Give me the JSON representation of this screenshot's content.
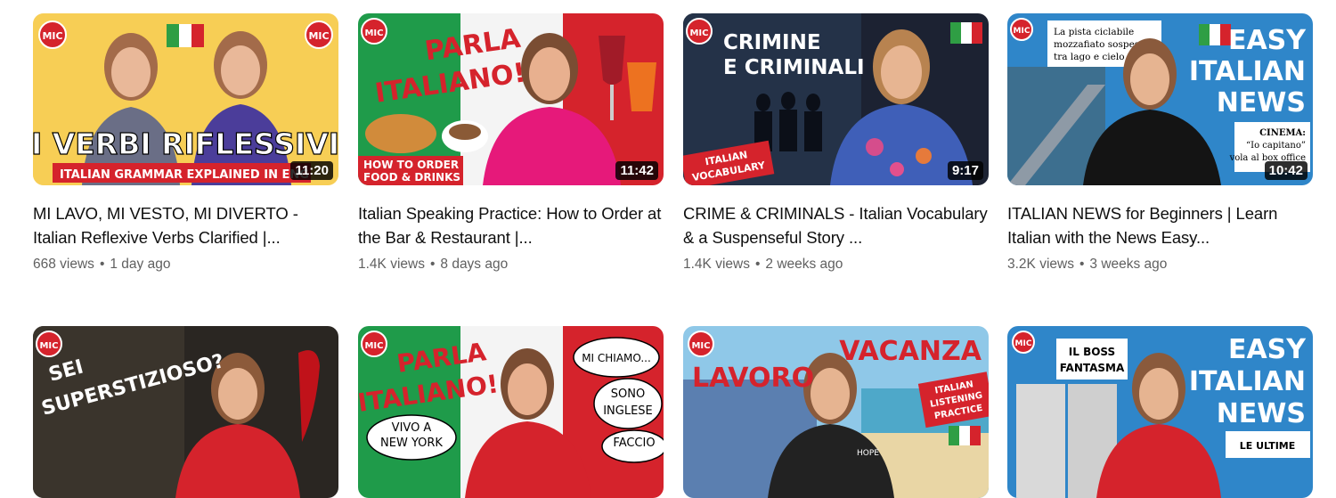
{
  "videos": [
    {
      "title": "MI LAVO, MI VESTO, MI DIVERTO - Italian Reflexive Verbs Clarified |...",
      "views": "668 views",
      "age": "1 day ago",
      "duration": "11:20",
      "thumb_text": [
        "I VERBI RIFLESSIVI",
        "ITALIAN GRAMMAR EXPLAINED IN ENG"
      ],
      "logo": "MIC"
    },
    {
      "title": "Italian Speaking Practice: How to Order at the Bar & Restaurant |...",
      "views": "1.4K views",
      "age": "8 days ago",
      "duration": "11:42",
      "thumb_text": [
        "PARLA",
        "ITALIANO!",
        "HOW TO ORDER",
        "FOOD & DRINKS"
      ],
      "logo": "MIC"
    },
    {
      "title": "CRIME & CRIMINALS - Italian Vocabulary & a Suspenseful Story ...",
      "views": "1.4K views",
      "age": "2 weeks ago",
      "duration": "9:17",
      "thumb_text": [
        "CRIMINE",
        "E CRIMINALI",
        "ITALIAN",
        "VOCABULARY"
      ],
      "logo": "MIC"
    },
    {
      "title": "ITALIAN NEWS for Beginners | Learn Italian with the News Easy...",
      "views": "3.2K views",
      "age": "3 weeks ago",
      "duration": "10:42",
      "thumb_text": [
        "EASY",
        "ITALIAN",
        "NEWS",
        "La pista ciclabile",
        "mozzafiato sospes",
        "tra lago e cielo",
        "CINEMA:",
        "“Io capitano”",
        "vola al box office"
      ],
      "logo": "MIC"
    },
    {
      "thumb_text": [
        "SEI",
        "SUPERSTIZIOSO?"
      ],
      "logo": "MIC"
    },
    {
      "thumb_text": [
        "PARLA",
        "ITALIANO!",
        "MI CHIAMO...",
        "SONO",
        "INGLESE",
        "VIVO A",
        "NEW YORK",
        "FACCIO"
      ],
      "logo": "MIC"
    },
    {
      "thumb_text": [
        "LAVORO",
        "VACANZA",
        "ITALIAN",
        "LISTENING",
        "PRACTICE",
        "HOPE"
      ],
      "logo": "MIC"
    },
    {
      "thumb_text": [
        "EASY",
        "ITALIAN",
        "NEWS",
        "IL BOSS",
        "FANTASMA",
        "LE ULTIME"
      ],
      "logo": "MIC"
    }
  ],
  "colors": {
    "title": "#0f0f0f",
    "meta": "#606060",
    "brand_red": "#d5232c",
    "duration_bg": "#000000"
  },
  "icons": {
    "flag": "italy-flag-icon",
    "logo": "mic-logo-icon"
  }
}
